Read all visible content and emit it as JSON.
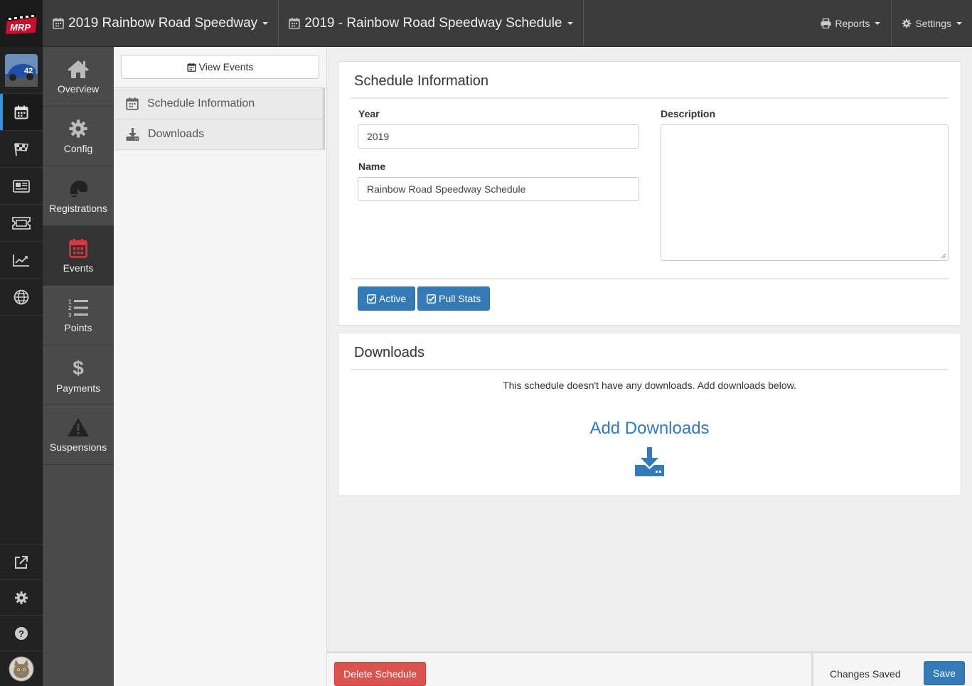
{
  "topbar": {
    "series": "2019 Rainbow Road Speedway",
    "schedule": "2019 - Rainbow Road Speedway Schedule",
    "reports": "Reports",
    "settings": "Settings"
  },
  "logo": "MRP",
  "modules": [
    {
      "label": "Overview",
      "icon": "home-icon"
    },
    {
      "label": "Config",
      "icon": "gear-icon"
    },
    {
      "label": "Registrations",
      "icon": "helmet-icon"
    },
    {
      "label": "Events",
      "icon": "calendar-icon"
    },
    {
      "label": "Points",
      "icon": "list-ordered-icon"
    },
    {
      "label": "Payments",
      "icon": "dollar-icon"
    },
    {
      "label": "Suspensions",
      "icon": "warning-icon"
    }
  ],
  "subnav": {
    "view_events": "View Events",
    "items": [
      "Schedule Information",
      "Downloads"
    ]
  },
  "schedule_info": {
    "title": "Schedule Information",
    "year_label": "Year",
    "year_value": "2019",
    "name_label": "Name",
    "name_value": "Rainbow Road Speedway Schedule",
    "description_label": "Description",
    "description_value": "",
    "active_label": "Active",
    "pull_stats_label": "Pull Stats"
  },
  "downloads": {
    "title": "Downloads",
    "empty_message": "This schedule doesn't have any downloads. Add downloads below.",
    "add_label": "Add Downloads"
  },
  "footer": {
    "delete_label": "Delete Schedule",
    "status": "Changes Saved",
    "save_label": "Save"
  },
  "colors": {
    "primary": "#337ab7",
    "danger": "#d9534f",
    "events_accent": "#d9363e",
    "rail_active": "#3a8ee6"
  }
}
